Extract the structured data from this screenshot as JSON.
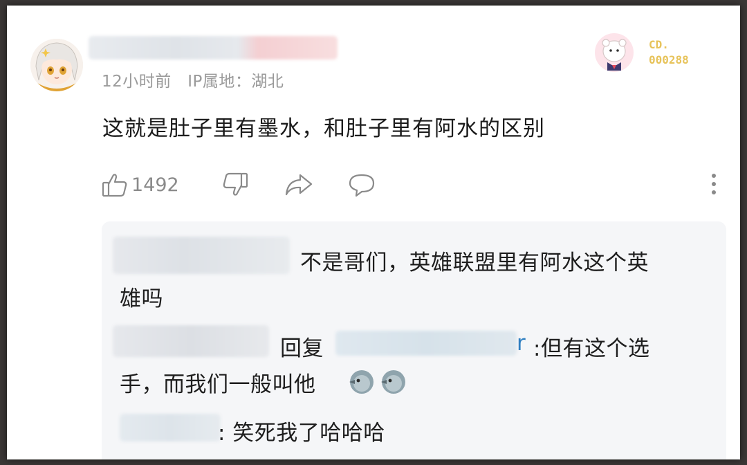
{
  "comment": {
    "time": "12小时前",
    "ip_label": "IP属地：",
    "ip_location": "湖北",
    "text": "这就是肚子里有墨水，和肚子里有阿水的区别",
    "like_count": "1492",
    "badge": {
      "line1": "CD.",
      "line2": "000288"
    }
  },
  "replies": [
    {
      "text_line1": "不是哥们，英雄联盟里有阿水这个英",
      "text_line2": "雄吗"
    },
    {
      "reply_word": "回复",
      "reply_target_end": "r",
      "text_line1": ":但有这个选",
      "text_line2": "手，而我们一般叫他"
    },
    {
      "text_line1": ": 笑死我了哈哈哈"
    }
  ],
  "colors": {
    "background": "#ffffff",
    "reply_box": "#f5f6f8",
    "meta_text": "#9a9a9a",
    "link_blue": "#2f7fc1",
    "badge_gold": "#e7c35a"
  }
}
